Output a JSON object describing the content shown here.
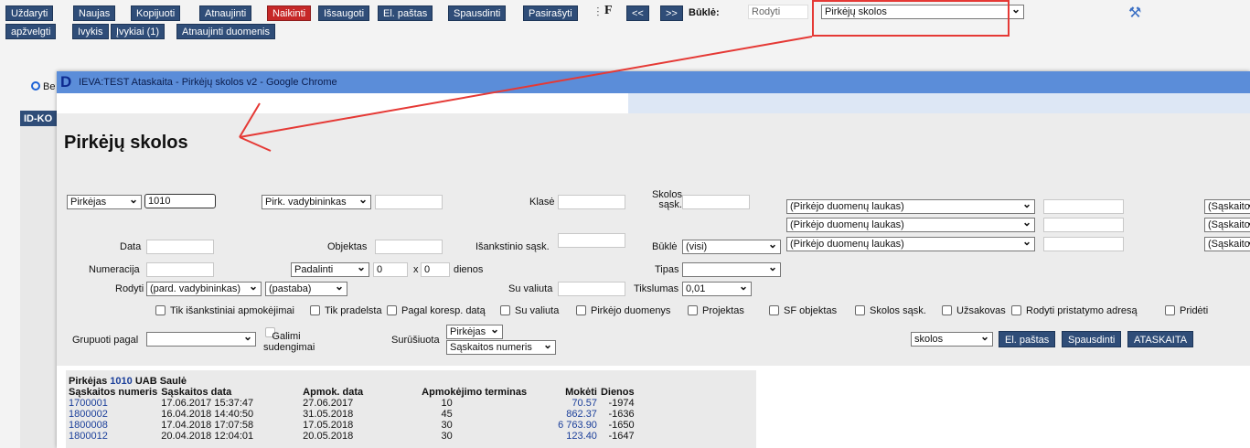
{
  "toolbar": {
    "row1": [
      "Uždaryti",
      "Naujas",
      "Kopijuoti",
      "Atnaujinti",
      "Naikinti",
      "Išsaugoti",
      "El. paštas",
      "Spausdinti",
      "Pasirašyti"
    ],
    "row2": [
      "apžvelgti",
      "Ivykis",
      "Įvykiai (1)",
      "Atnaujinti duomenis"
    ],
    "nav_prev": "<<",
    "nav_next": ">>",
    "status_label": "Būklė:",
    "status_value": "Rodyti",
    "report_select": "Pirkėjų skolos"
  },
  "bg": {
    "radio_label": "Be",
    "header_label": "ID-KO"
  },
  "popup": {
    "title": "IEVA:TEST Ataskaita - Pirkėjų skolos v2 - Google Chrome",
    "heading": "Pirkėjų skolos",
    "filters": {
      "pirkejas_select": "Pirkėjas",
      "pirkejas_value": "1010",
      "vadybininkas_select": "Pirk. vadybininkas",
      "klase": "Klasė",
      "skolos_sask": "Skolos sąsk.",
      "duom_laukas": [
        "(Pirkėjo duomenų laukas)",
        "(Pirkėjo duomenų laukas)",
        "(Pirkėjo duomenų laukas)"
      ],
      "saskaitos_cut": [
        "(Sąskaito",
        "(Sąskaito",
        "(Sąskaito"
      ],
      "data": "Data",
      "objektas": "Objektas",
      "isankstinio": "Išankstinio sąsk.",
      "bukle_label": "Būklė",
      "bukle_value": "(visi)",
      "numeracija": "Numeracija",
      "padalinti": "Padalinti",
      "padalinti_a": "0",
      "x_label": "x",
      "padalinti_b": "0",
      "dienos": "dienos",
      "tipas": "Tipas",
      "rodyti": "Rodyti",
      "rodyti_a": "(pard. vadybininkas)",
      "rodyti_b": "(pastaba)",
      "su_valiuta": "Su valiuta",
      "tikslumas": "Tikslumas",
      "tikslumas_value": "0,01",
      "checkboxes": [
        "Tik išankstiniai apmokėjimai",
        "Tik pradelsta",
        "Pagal koresp. datą",
        "Su valiuta",
        "Pirkėjo duomenys",
        "Projektas",
        "SF objektas",
        "Skolos sąsk.",
        "Užsakovas",
        "Rodyti pristatymo adresą",
        "Pridėti"
      ],
      "grupuoti": "Grupuoti pagal",
      "galimi": "Galimi sudengimai",
      "surusiuota": "Surūšiuota",
      "sort_a": "Pirkėjas",
      "sort_b": "Sąskaitos numeris",
      "output_select": "skolos",
      "btn_email": "El. paštas",
      "btn_print": "Spausdinti",
      "btn_report": "ATASKAITA"
    },
    "results": {
      "group_prefix": "Pirkėjas",
      "group_code": "1010",
      "group_name": "UAB Saulė",
      "headers": [
        "Sąskaitos numeris",
        "Sąskaitos data",
        "Apmok. data",
        "Apmokėjimo terminas",
        "Mokėti",
        "Dienos"
      ],
      "rows": [
        [
          "1700001",
          "17.06.2017 15:37:47",
          "27.06.2017",
          "10",
          "70.57",
          "-1974"
        ],
        [
          "1800002",
          "16.04.2018 14:40:50",
          "31.05.2018",
          "45",
          "862.37",
          "-1636"
        ],
        [
          "1800008",
          "17.04.2018 17:07:58",
          "17.05.2018",
          "30",
          "6 763.90",
          "-1650"
        ],
        [
          "1800012",
          "20.04.2018 12:04:01",
          "20.05.2018",
          "30",
          "123.40",
          "-1647"
        ]
      ]
    }
  },
  "colors": {
    "toolbar": "#2f4d78",
    "delete": "#c62828",
    "annotation": "#e53935",
    "title_bar": "#5b8dd9"
  }
}
